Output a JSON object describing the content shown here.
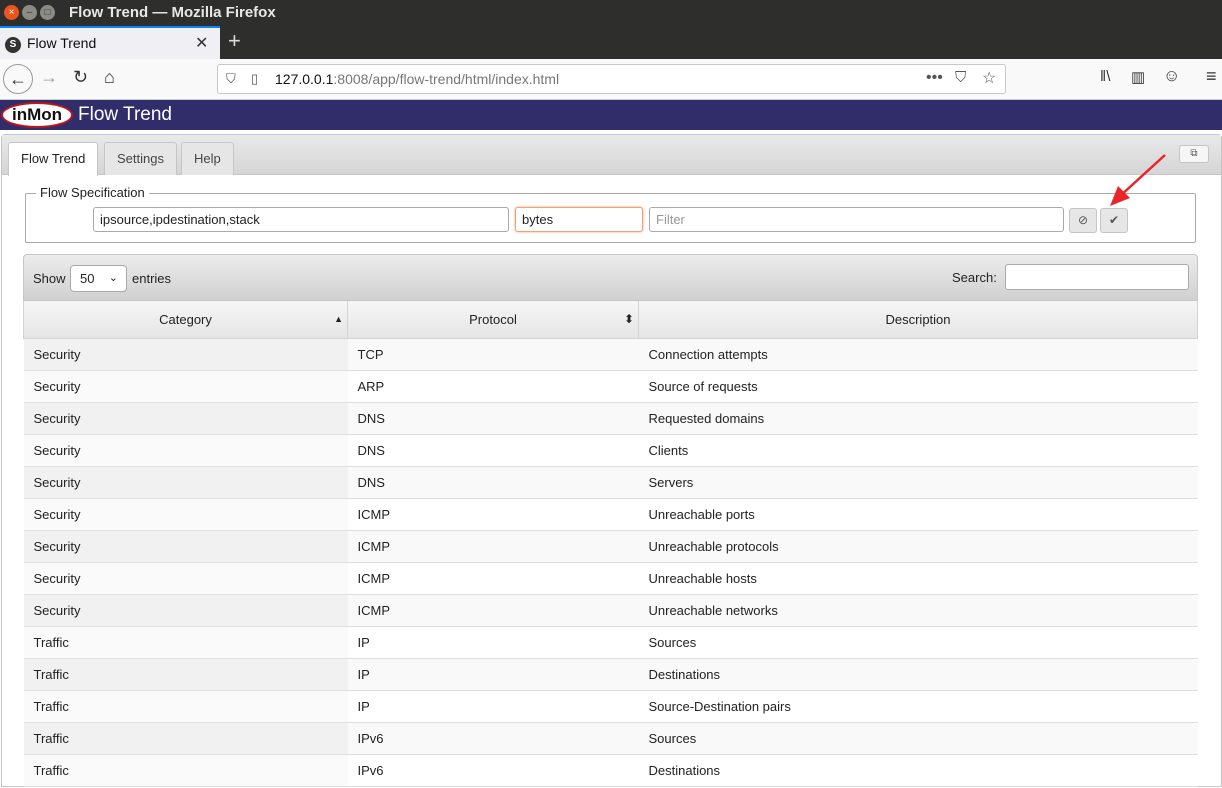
{
  "window": {
    "title": "Flow Trend — Mozilla Firefox",
    "close": "×",
    "min": "–",
    "max": "□"
  },
  "browser": {
    "tab_title": "Flow Trend",
    "tab_favicon": "S",
    "tab_close": "✕",
    "new_tab": "+",
    "url_host": "127.0.0.1",
    "url_rest": ":8008/app/flow-trend/html/index.html",
    "icons": {
      "back": "←",
      "forward": "→",
      "reload": "↻",
      "home": "⌂",
      "shield": "⛉",
      "page": "▯",
      "more": "•••",
      "pocket": "⛉",
      "star": "☆",
      "library": "‖\\",
      "sidebar": "▥",
      "account": "☺",
      "menu": "≡"
    }
  },
  "app": {
    "logo": "inMon",
    "title": "Flow Trend",
    "brand_color": "#302d6a",
    "tabs": [
      "Flow Trend",
      "Settings",
      "Help"
    ],
    "popout": "⧉"
  },
  "flowspec": {
    "legend": "Flow Specification",
    "keys": "ipsource,ipdestination,stack",
    "value": "bytes",
    "filter_placeholder": "Filter",
    "clear_icon": "⊘",
    "submit_icon": "✔"
  },
  "table": {
    "show_label": "Show",
    "length": "50",
    "entries_label": "entries",
    "search_label": "Search:",
    "sort_up": "▲",
    "sort_both": "⬍",
    "columns": [
      "Category",
      "Protocol",
      "Description"
    ],
    "rows": [
      [
        "Security",
        "TCP",
        "Connection attempts"
      ],
      [
        "Security",
        "ARP",
        "Source of requests"
      ],
      [
        "Security",
        "DNS",
        "Requested domains"
      ],
      [
        "Security",
        "DNS",
        "Clients"
      ],
      [
        "Security",
        "DNS",
        "Servers"
      ],
      [
        "Security",
        "ICMP",
        "Unreachable ports"
      ],
      [
        "Security",
        "ICMP",
        "Unreachable protocols"
      ],
      [
        "Security",
        "ICMP",
        "Unreachable hosts"
      ],
      [
        "Security",
        "ICMP",
        "Unreachable networks"
      ],
      [
        "Traffic",
        "IP",
        "Sources"
      ],
      [
        "Traffic",
        "IP",
        "Destinations"
      ],
      [
        "Traffic",
        "IP",
        "Source-Destination pairs"
      ],
      [
        "Traffic",
        "IPv6",
        "Sources"
      ],
      [
        "Traffic",
        "IPv6",
        "Destinations"
      ]
    ]
  },
  "annotation_color": "#e8262a"
}
